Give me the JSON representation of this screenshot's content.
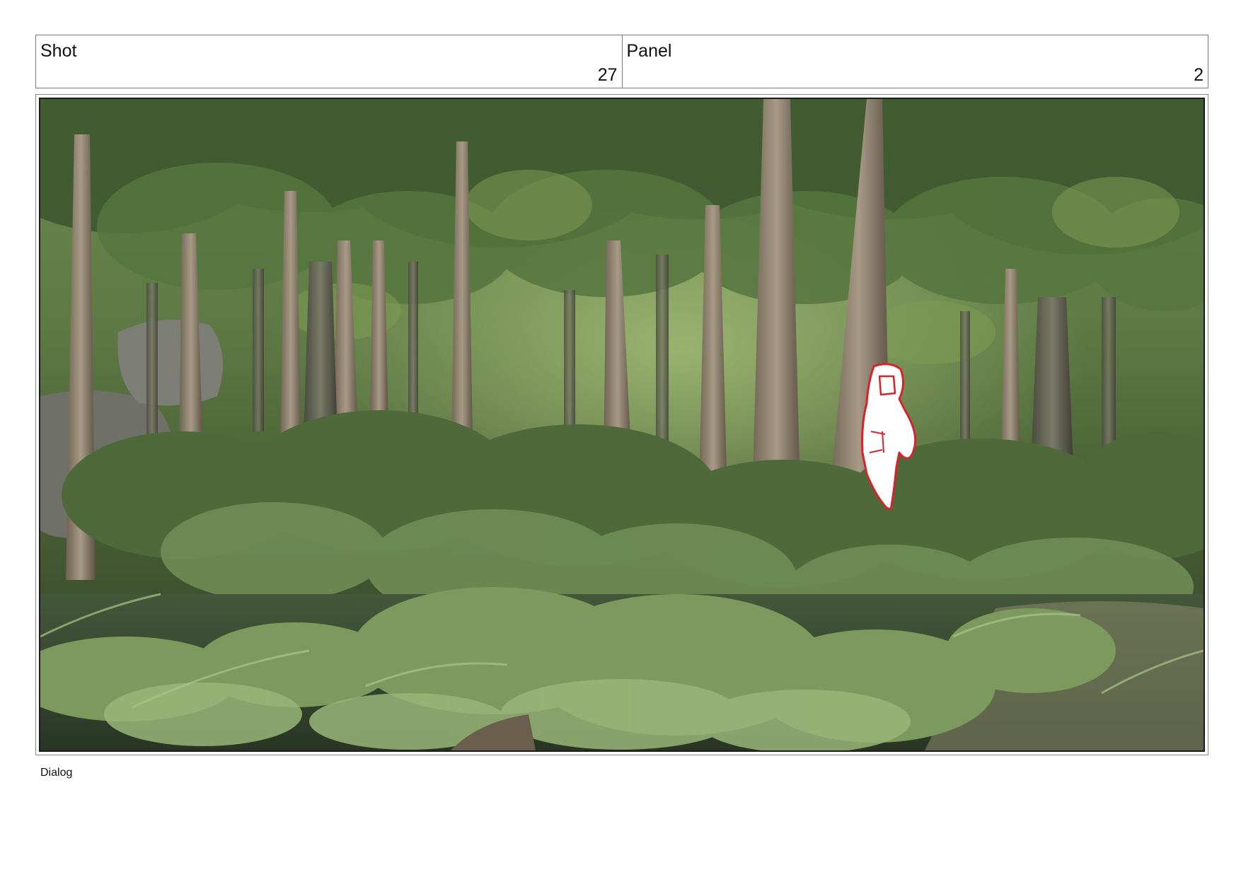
{
  "header": {
    "shot_label": "Shot",
    "shot_value": "27",
    "panel_label": "Panel",
    "panel_value": "2"
  },
  "panel_image": {
    "icon": "forest-scene-image",
    "figure_outline_color": "#d8232a"
  },
  "footer": {
    "dialog_label": "Dialog"
  }
}
